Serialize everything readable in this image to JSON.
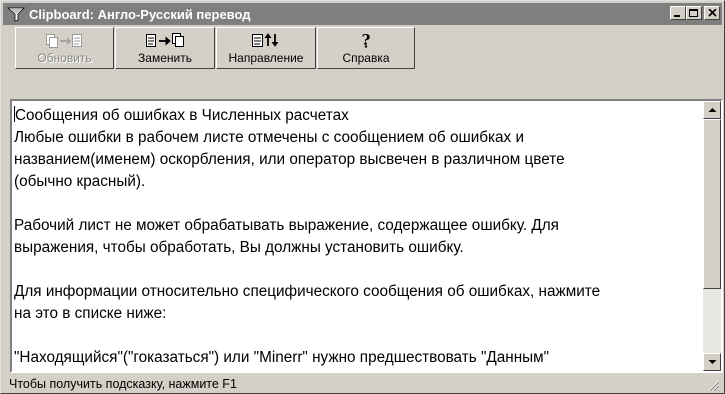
{
  "window": {
    "title": "Clipboard: Англо-Русский перевод",
    "controls": {
      "minimize": "minimize",
      "maximize": "maximize",
      "close": "close"
    }
  },
  "toolbar": {
    "buttons": [
      {
        "label": "Обновить",
        "icon": "refresh-copy-icon",
        "enabled": false
      },
      {
        "label": "Заменить",
        "icon": "replace-icon",
        "enabled": true
      },
      {
        "label": "Направление",
        "icon": "direction-icon",
        "enabled": true
      },
      {
        "label": "Справка",
        "icon": "help-icon",
        "enabled": true
      }
    ]
  },
  "content": {
    "lines": [
      "Сообщения об ошибках в Численных расчетах",
      "Любые ошибки в рабочем листе отмечены с сообщением об ошибках и",
      "названием(именем) оскорбления, или оператор высвечен в различном цвете",
      "(обычно красный).",
      "",
      "Рабочий лист не может обрабатывать выражение, содержащее ошибку. Для",
      "выражения, чтобы обработать, Вы должны установить ошибку.",
      "",
      "Для информации относительно специфического сообщения об ошибках, нажмите",
      "на это в списке ниже:",
      "",
      "\"Находящийся\"(\"гоказаться\") или \"Minerr\" нужно предшествовать \"Данным\""
    ]
  },
  "statusbar": {
    "text": "Чтобы получить подсказку, нажмите F1"
  },
  "colors": {
    "titlebar": "#7f7f7f",
    "face": "#d4d0c8",
    "text_bg": "#ffffff"
  }
}
